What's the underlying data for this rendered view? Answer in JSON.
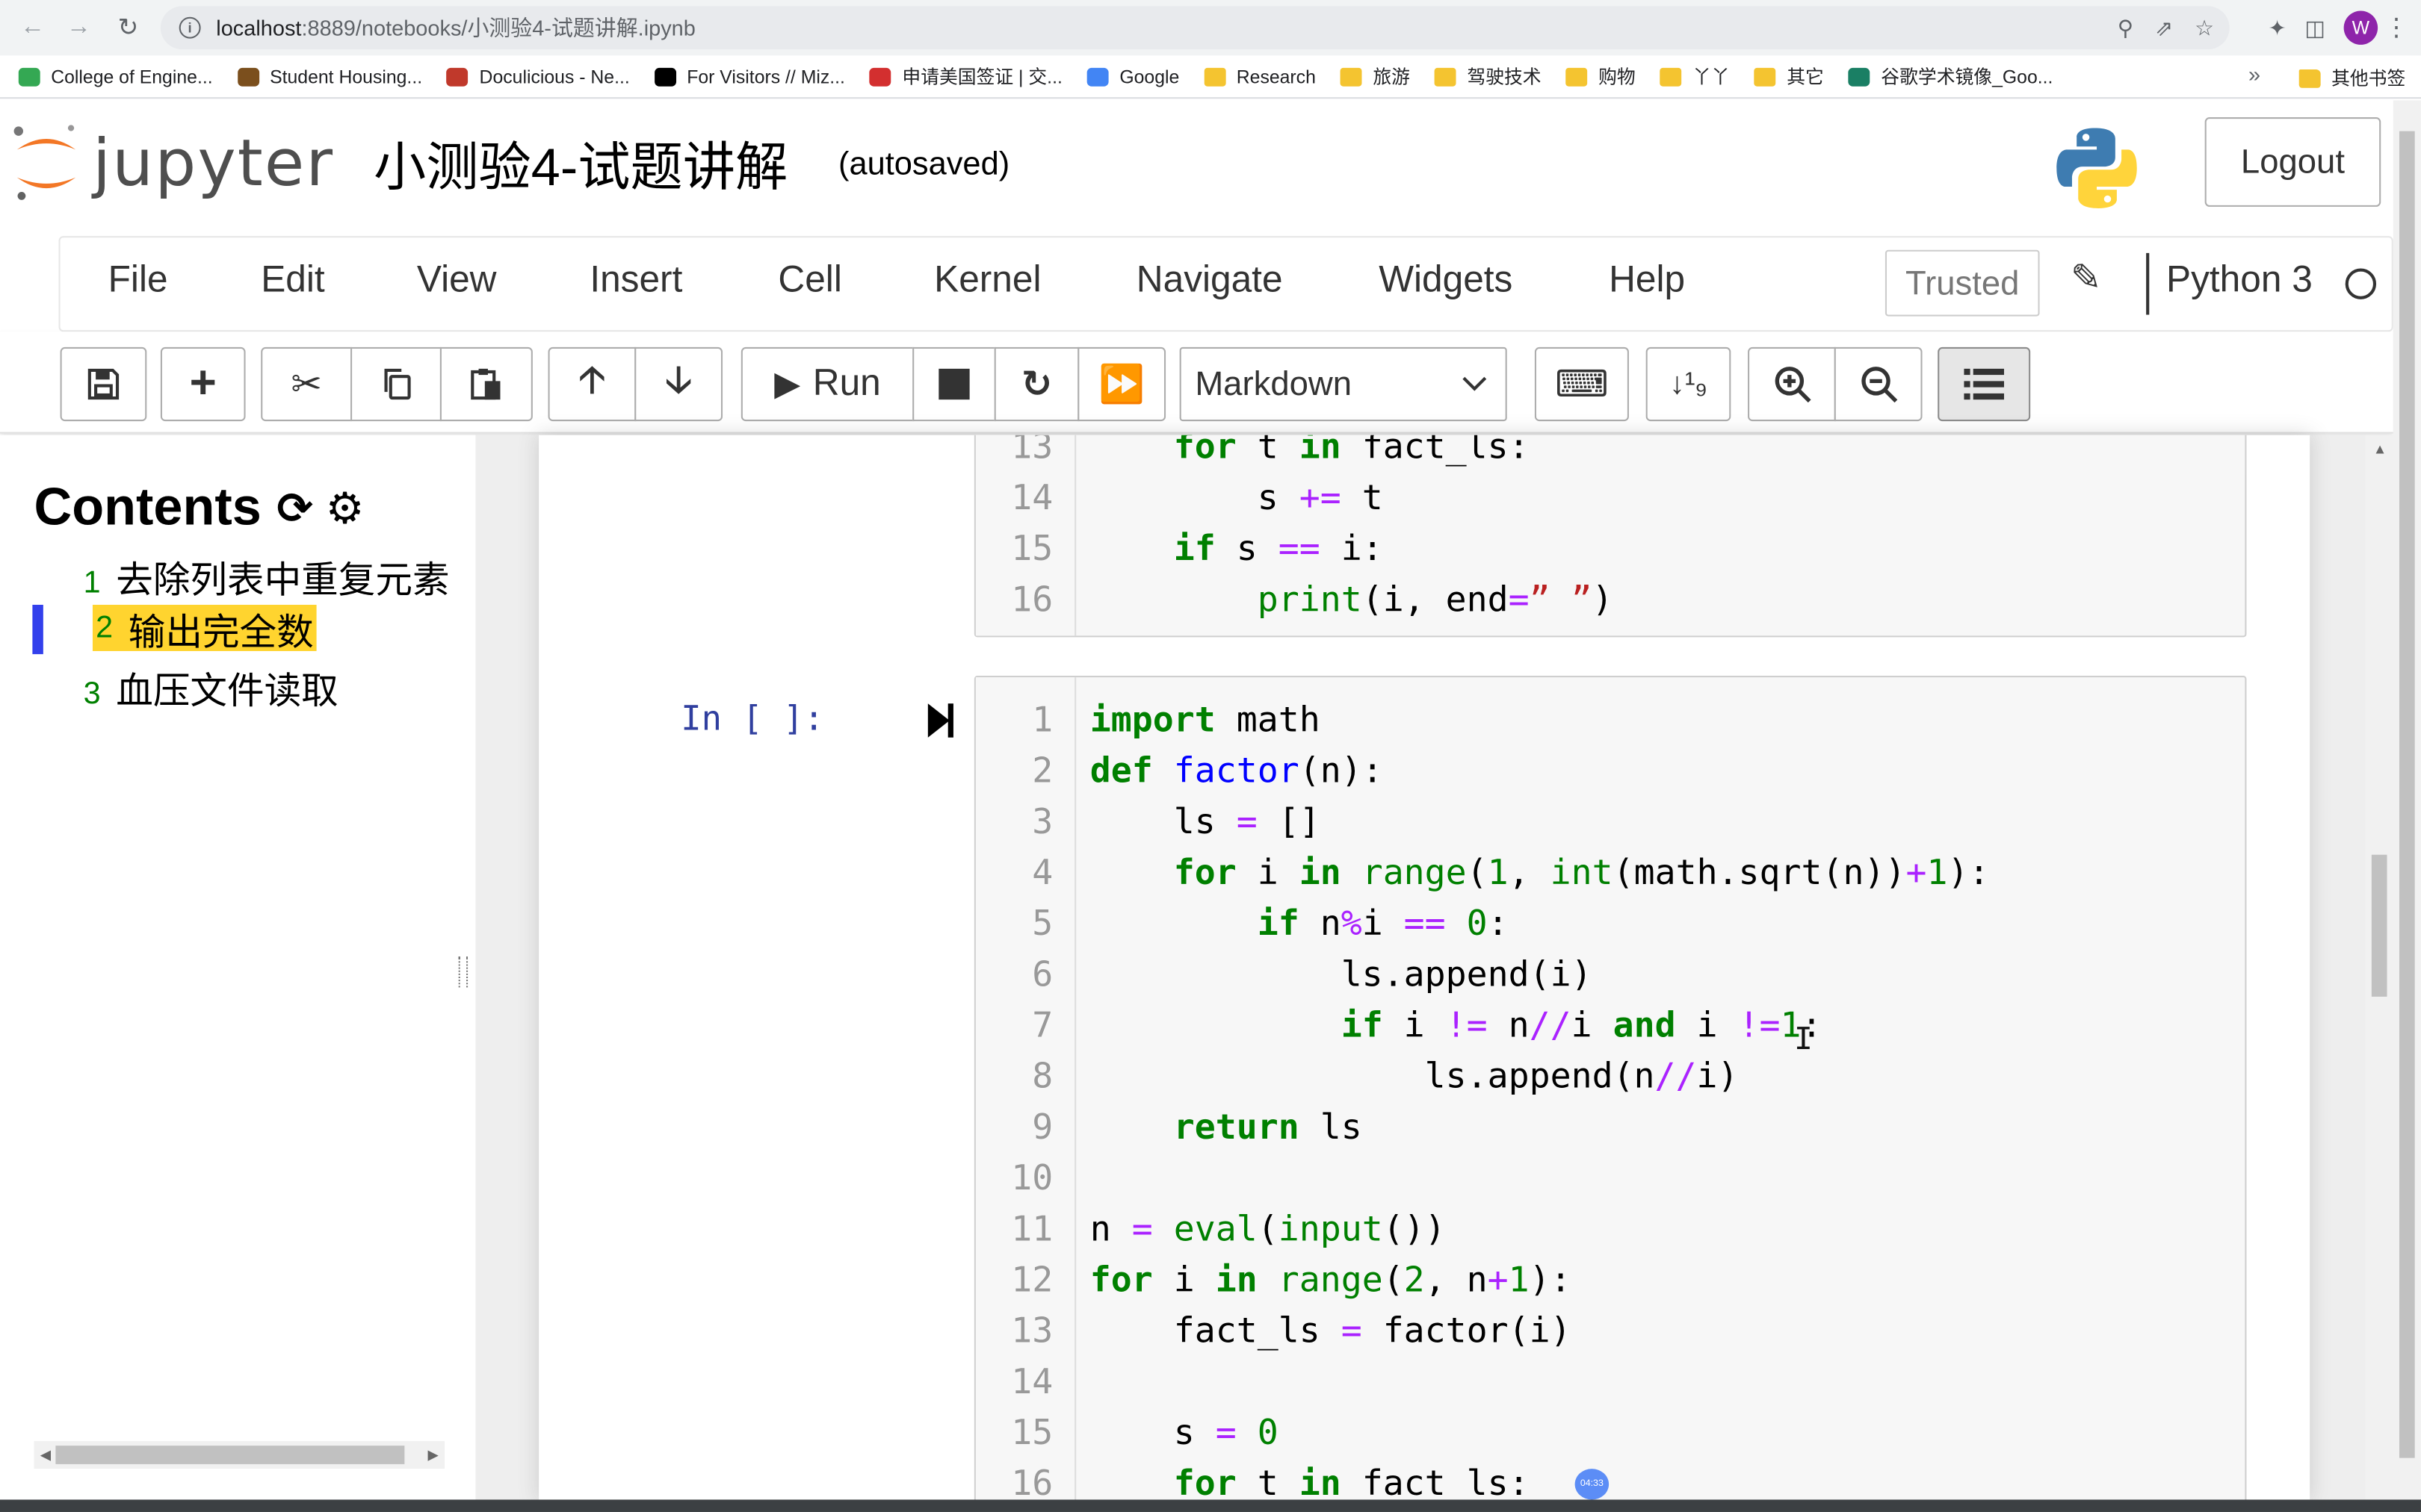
{
  "browser": {
    "url_host": "localhost",
    "url_rest": ":8889/notebooks/小测验4-试题讲解.ipynb",
    "avatar_letter": "W",
    "bookmarks": [
      {
        "label": "College of Engine...",
        "icon": "maps-icon",
        "color": "#34a853"
      },
      {
        "label": "Student Housing...",
        "icon": "building-icon",
        "color": "#7b4f1d"
      },
      {
        "label": "Doculicious - Ne...",
        "icon": "doculicious-icon",
        "color": "#c0392b"
      },
      {
        "label": "For Visitors // Miz...",
        "icon": "mizzou-icon",
        "color": "#000000"
      },
      {
        "label": "申请美国签证 | 交...",
        "icon": "visa-icon",
        "color": "#d32f2f"
      },
      {
        "label": "Google",
        "icon": "google-icon",
        "color": "#4285f4"
      },
      {
        "label": "Research",
        "icon": "folder-icon",
        "color": "#f4c430"
      },
      {
        "label": "旅游",
        "icon": "folder-icon",
        "color": "#f4c430"
      },
      {
        "label": "驾驶技术",
        "icon": "folder-icon",
        "color": "#f4c430"
      },
      {
        "label": "购物",
        "icon": "folder-icon",
        "color": "#f4c430"
      },
      {
        "label": "丫丫",
        "icon": "folder-icon",
        "color": "#f4c430"
      },
      {
        "label": "其它",
        "icon": "folder-icon",
        "color": "#f4c430"
      },
      {
        "label": "谷歌学术镜像_Goo...",
        "icon": "scholar-icon",
        "color": "#1a7f64"
      }
    ],
    "more": "»",
    "other_bookmarks": "其他书签"
  },
  "header": {
    "logo_text": "jupyter",
    "title": "小测验4-试题讲解",
    "autosave": "(autosaved)",
    "logout": "Logout"
  },
  "menubar": {
    "items": [
      "File",
      "Edit",
      "View",
      "Insert",
      "Cell",
      "Kernel",
      "Navigate",
      "Widgets",
      "Help"
    ],
    "trusted": "Trusted",
    "kernel": "Python 3"
  },
  "toolbar": {
    "run_label": "Run",
    "cell_type": "Markdown"
  },
  "toc": {
    "title": "Contents",
    "items": [
      {
        "num": "1",
        "label": "去除列表中重复元素"
      },
      {
        "num": "2",
        "label": "输出完全数"
      },
      {
        "num": "3",
        "label": "血压文件读取"
      }
    ]
  },
  "cell_prev": {
    "lines": [
      {
        "n": "13",
        "html": "    <span class=\"kw\">for</span> t <span class=\"kw\">in</span> fact_ls:"
      },
      {
        "n": "14",
        "html": "        s <span class=\"op\">+=</span> t"
      },
      {
        "n": "15",
        "html": "    <span class=\"kw\">if</span> s <span class=\"op\">==</span> i:"
      },
      {
        "n": "16",
        "html": "        <span class=\"bi\">print</span>(i, end<span class=\"op\">=</span><span class=\"str\">” ”</span>)"
      }
    ]
  },
  "cell_current": {
    "prompt": "In  [  ]:",
    "lines": [
      {
        "n": "1",
        "html": "<span class=\"kw\">import</span> math"
      },
      {
        "n": "2",
        "html": "<span class=\"kw\">def</span> <span class=\"def\">factor</span>(n):"
      },
      {
        "n": "3",
        "html": "    ls <span class=\"op\">=</span> []"
      },
      {
        "n": "4",
        "html": "    <span class=\"kw\">for</span> i <span class=\"kw\">in</span> <span class=\"bi\">range</span>(<span class=\"num\">1</span>, <span class=\"bi\">int</span>(math.sqrt(n))<span class=\"op\">+</span><span class=\"num\">1</span>):"
      },
      {
        "n": "5",
        "html": "        <span class=\"kw\">if</span> n<span class=\"op\">%</span>i <span class=\"op\">==</span> <span class=\"num\">0</span>:"
      },
      {
        "n": "6",
        "html": "            ls.append(i)"
      },
      {
        "n": "7",
        "html": "            <span class=\"kw\">if</span> i <span class=\"op\">!=</span> n<span class=\"op\">//</span>i <span class=\"kw\">and</span> i <span class=\"op\">!=</span><span class=\"num\">1</span>:"
      },
      {
        "n": "8",
        "html": "                ls.append(n<span class=\"op\">//</span>i)"
      },
      {
        "n": "9",
        "html": "    <span class=\"kw\">return</span> ls"
      },
      {
        "n": "10",
        "html": ""
      },
      {
        "n": "11",
        "html": "n <span class=\"op\">=</span> <span class=\"bi\">eval</span>(<span class=\"bi\">input</span>())"
      },
      {
        "n": "12",
        "html": "<span class=\"kw\">for</span> i <span class=\"kw\">in</span> <span class=\"bi\">range</span>(<span class=\"num\">2</span>, n<span class=\"op\">+</span><span class=\"num\">1</span>):"
      },
      {
        "n": "13",
        "html": "    fact_ls <span class=\"op\">=</span> factor(i)"
      },
      {
        "n": "14",
        "html": ""
      },
      {
        "n": "15",
        "html": "    s <span class=\"op\">=</span> <span class=\"num\">0</span>"
      },
      {
        "n": "16",
        "html": "    <span class=\"kw\">for</span> t <span class=\"kw\">in</span> fact_ls:"
      }
    ]
  },
  "timer": "04:33"
}
